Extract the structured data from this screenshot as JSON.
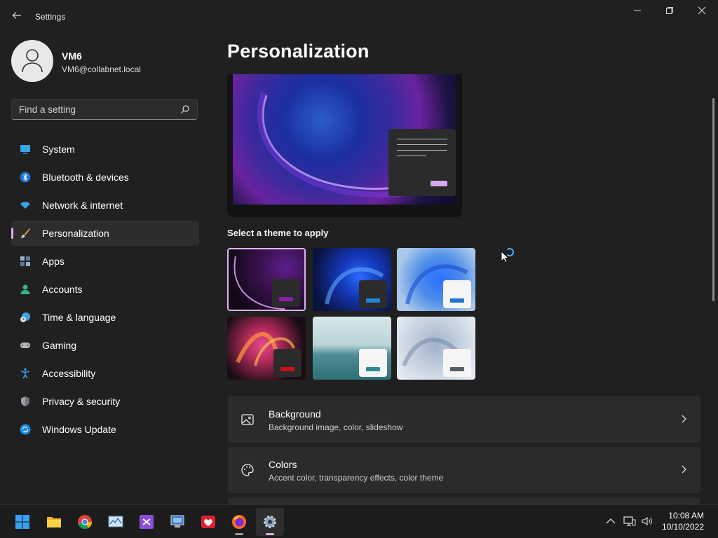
{
  "window": {
    "title": "Settings",
    "controls": [
      "minimize",
      "restore",
      "close"
    ],
    "icons": {
      "back": "back-arrow-icon",
      "minimize": "minimize-icon",
      "restore": "restore-icon",
      "close": "close-icon"
    }
  },
  "user": {
    "name": "VM6",
    "email": "VM6@collabnet.local"
  },
  "search": {
    "placeholder": "Find a setting"
  },
  "sidebar": {
    "items": [
      {
        "label": "System",
        "icon": "system-icon",
        "active": false
      },
      {
        "label": "Bluetooth & devices",
        "icon": "bluetooth-icon",
        "active": false
      },
      {
        "label": "Network & internet",
        "icon": "wifi-icon",
        "active": false
      },
      {
        "label": "Personalization",
        "icon": "brush-icon",
        "active": true
      },
      {
        "label": "Apps",
        "icon": "apps-icon",
        "active": false
      },
      {
        "label": "Accounts",
        "icon": "account-icon",
        "active": false
      },
      {
        "label": "Time & language",
        "icon": "clock-globe-icon",
        "active": false
      },
      {
        "label": "Gaming",
        "icon": "gamepad-icon",
        "active": false
      },
      {
        "label": "Accessibility",
        "icon": "accessibility-icon",
        "active": false
      },
      {
        "label": "Privacy & security",
        "icon": "shield-icon",
        "active": false
      },
      {
        "label": "Windows Update",
        "icon": "update-icon",
        "active": false
      }
    ]
  },
  "main": {
    "title": "Personalization",
    "theme_section_label": "Select a theme to apply",
    "themes": [
      {
        "name": "windows-dark-bloom",
        "accent": "#8a1fa8",
        "selected": true
      },
      {
        "name": "windows-dark",
        "accent": "#1e86d6",
        "selected": false
      },
      {
        "name": "windows-light",
        "accent": "#1e78d0",
        "selected": false
      },
      {
        "name": "glow",
        "accent": "#cc1020",
        "selected": false
      },
      {
        "name": "captured-motion",
        "accent": "#2e8c92",
        "selected": false
      },
      {
        "name": "flow",
        "accent": "#5a5e68",
        "selected": false
      }
    ],
    "cards": [
      {
        "title": "Background",
        "subtitle": "Background image, color, slideshow",
        "icon": "image-icon"
      },
      {
        "title": "Colors",
        "subtitle": "Accent color, transparency effects, color theme",
        "icon": "palette-icon"
      }
    ]
  },
  "taskbar": {
    "apps": [
      {
        "name": "start",
        "icon": "windows-start-icon",
        "running": false
      },
      {
        "name": "file-explorer",
        "icon": "folder-icon",
        "running": false
      },
      {
        "name": "chrome",
        "icon": "chrome-icon",
        "running": false
      },
      {
        "name": "resource-monitor",
        "icon": "monitor-graph-icon",
        "running": false
      },
      {
        "name": "visual-studio",
        "icon": "visual-studio-icon",
        "running": false
      },
      {
        "name": "remote-desktop",
        "icon": "remote-desktop-icon",
        "running": false
      },
      {
        "name": "heart-app",
        "icon": "heart-logo-icon",
        "running": false
      },
      {
        "name": "firefox",
        "icon": "firefox-icon",
        "running": true
      },
      {
        "name": "settings",
        "icon": "settings-gear-icon",
        "running": true,
        "active": true
      }
    ],
    "tray": [
      "chevron-up-icon",
      "network-icon",
      "volume-icon"
    ],
    "clock": {
      "time": "10:08 AM",
      "date": "10/10/2022"
    }
  },
  "colors": {
    "accent": "#e8a5ee",
    "background": "#202020",
    "card": "#2b2b2b"
  }
}
